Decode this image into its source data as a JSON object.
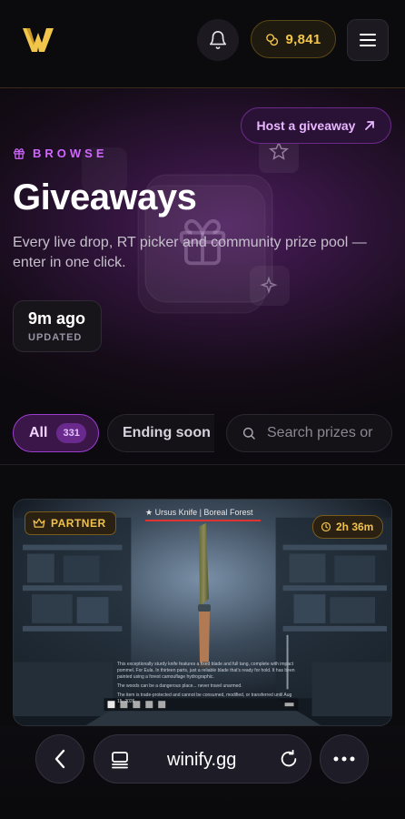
{
  "header": {
    "logo": "winify-logo",
    "coins": "9,841",
    "colors": {
      "gold": "#f2c64a",
      "accent": "#b14de8",
      "background": "#0b0a0d"
    }
  },
  "hero": {
    "host_button": "Host a giveaway",
    "eyebrow": "BROWSE",
    "title": "Giveaways",
    "subtitle": "Every live drop, RT picker and community prize pool — enter in one click.",
    "updated_time": "9m ago",
    "updated_label": "UPDATED"
  },
  "filters": {
    "all_label": "All",
    "all_count": "331",
    "ending_label": "Ending soon",
    "search_placeholder": "Search prizes or"
  },
  "card": {
    "badge": "PARTNER",
    "time_left": "2h 36m",
    "item_name": "★ Ursus Knife | Boreal Forest",
    "description_lines": [
      "This exceptionally sturdy knife features a fixed blade and full tang, complete with impact pommel. For Eula. In thirteen parts, just a reliable blade that's ready for hold. It has been painted using a forest camouflage hydrographic.",
      "The woods can be a dangerous place... never travel unarmed.",
      "The item is trade-protected and cannot be consumed, modified, or transferred until Aug 15, 2026"
    ]
  },
  "browser": {
    "url": "winify.gg"
  }
}
